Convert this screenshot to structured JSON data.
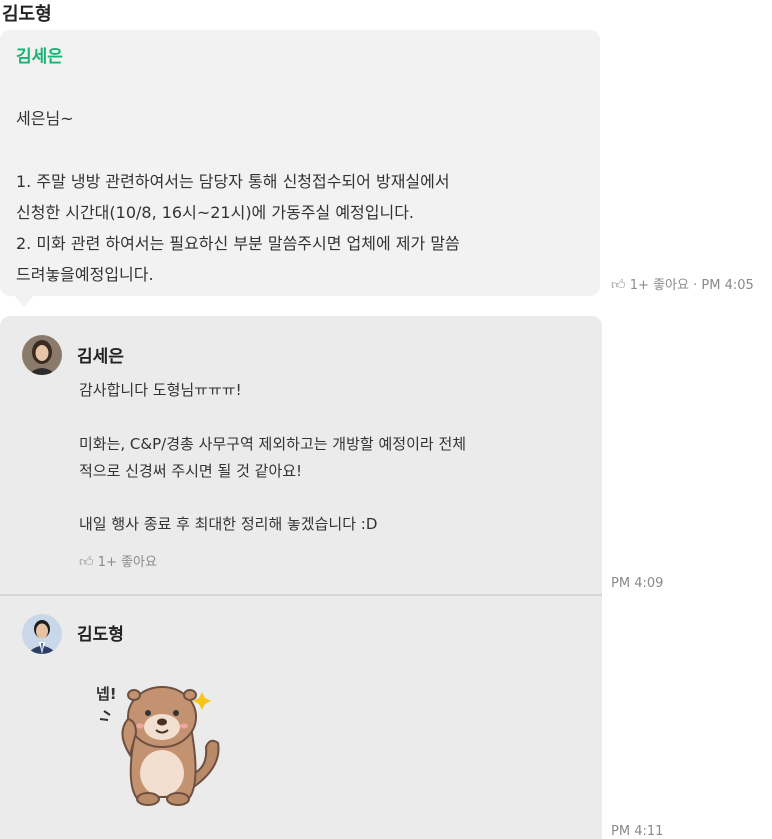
{
  "message": {
    "sender": "김도형",
    "quoted_sender": "김세은",
    "lines": [
      "세은님~",
      "1. 주말 냉방 관련하여서는 담당자 통해 신청접수되어 방재실에서",
      "신청한 시간대(10/8, 16시~21시)에 가동주실 예정입니다.",
      "2. 미화 관련 하여서는 필요하신 부분 말씀주시면 업체에 제가 말씀",
      "드려놓을예정입니다."
    ],
    "reaction": "1+ 좋아요",
    "separator": "·",
    "time": "PM 4:05"
  },
  "replies": [
    {
      "sender": "김세은",
      "lines": [
        "감사합니다 도형님ㅠㅠㅠ!",
        "미화는, C&P/경총 사무구역 제외하고는 개방할 예정이라 전체",
        "적으로 신경써 주시면 될 것 같아요!",
        "내일 행사 종료 후 최대한 정리해 놓겠습니다 :D"
      ],
      "reaction": "1+ 좋아요",
      "time": "PM 4:09"
    },
    {
      "sender": "김도형",
      "sticker_text": "넵!",
      "time": "PM 4:11"
    }
  ],
  "icons": {
    "like": "thumbs-up-icon"
  },
  "colors": {
    "quoted_name": "#19b37a",
    "bubble": "#f2f2f2",
    "thread": "#ebebeb"
  }
}
